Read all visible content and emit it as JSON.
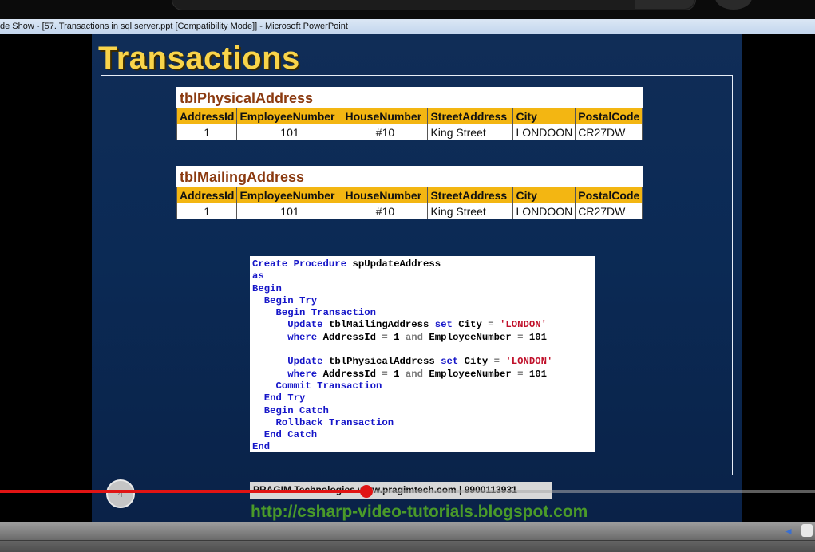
{
  "window": {
    "title": "de Show - [57. Transactions in sql server.ppt [Compatibility Mode]] - Microsoft PowerPoint"
  },
  "slide": {
    "title": "Transactions",
    "number": "4",
    "footer_brand": "PRAGIM Technologies",
    "footer_contact": "www.pragimtech.com | 9900113931",
    "blog_url": "http://csharp-video-tutorials.blogspot.com"
  },
  "tables": [
    {
      "name": "tblPhysicalAddress",
      "columns": [
        "AddressId",
        "EmployeeNumber",
        "HouseNumber",
        "StreetAddress",
        "City",
        "PostalCode"
      ],
      "rows": [
        [
          "1",
          "101",
          "#10",
          "King Street",
          "LONDOON",
          "CR27DW"
        ]
      ]
    },
    {
      "name": "tblMailingAddress",
      "columns": [
        "AddressId",
        "EmployeeNumber",
        "HouseNumber",
        "StreetAddress",
        "City",
        "PostalCode"
      ],
      "rows": [
        [
          "1",
          "101",
          "#10",
          "King Street",
          "LONDOON",
          "CR27DW"
        ]
      ]
    }
  ],
  "code": {
    "l1_kw": "Create Procedure",
    "l1_rest": " spUpdateAddress",
    "l2_kw": "as",
    "l3_kw": "Begin",
    "l4_kw": "Begin Try",
    "l5_kw": "Begin Transaction",
    "l6_kw1": "Update",
    "l6_t": " tblMailingAddress ",
    "l6_kw2": "set",
    "l6_c": " City ",
    "l6_op": "=",
    "l6_str": " 'LONDON'",
    "l7_kw": "where",
    "l7_a": " AddressId ",
    "l7_op1": "=",
    "l7_b": " 1 ",
    "l7_kw2": "and",
    "l7_c": " EmployeeNumber ",
    "l7_op2": "=",
    "l7_d": " 101",
    "l9_kw1": "Update",
    "l9_t": " tblPhysicalAddress ",
    "l9_kw2": "set",
    "l9_c": " City ",
    "l9_op": "=",
    "l9_str": " 'LONDON'",
    "l10_kw": "where",
    "l10_a": " AddressId ",
    "l10_op1": "=",
    "l10_b": " 1 ",
    "l10_kw2": "and",
    "l10_c": " EmployeeNumber ",
    "l10_op2": "=",
    "l10_d": " 101",
    "l11_kw": "Commit Transaction",
    "l12_kw": "End Try",
    "l13_kw": "Begin Catch",
    "l14_kw": "Rollback Transaction",
    "l15_kw": "End Catch",
    "l16_kw": "End"
  },
  "player": {
    "progress_fraction": 0.45
  }
}
